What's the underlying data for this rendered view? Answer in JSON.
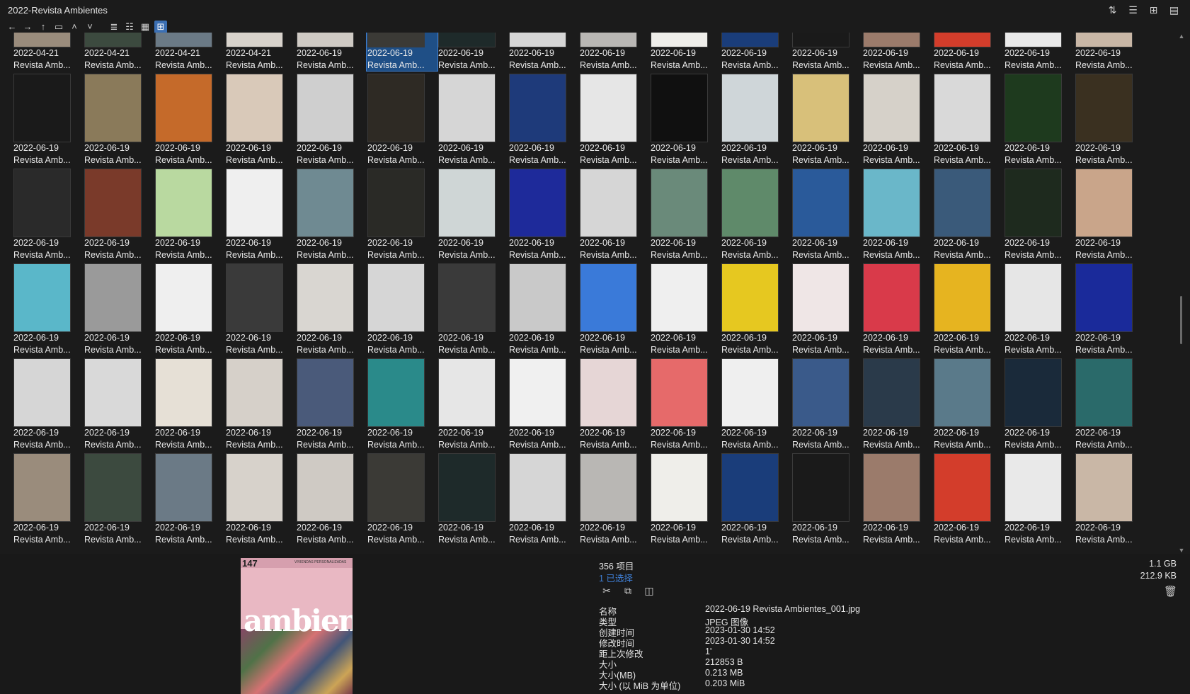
{
  "window": {
    "title": "2022-Revista Ambientes"
  },
  "icons": {
    "sort": "sort-icon",
    "details": "details-view-icon",
    "add": "add-pane-icon",
    "clipboard": "clipboard-icon",
    "back": "back-arrow-icon",
    "forward": "forward-arrow-icon",
    "up": "up-arrow-icon",
    "folder": "folder-icon",
    "chev_up": "chevron-up-icon",
    "chev_down": "chevron-down-icon"
  },
  "grid": {
    "rows": [
      [
        "2022-04-21",
        "2022-04-21",
        "2022-04-21",
        "2022-04-21",
        "2022-06-19",
        "2022-06-19",
        "2022-06-19",
        "2022-06-19",
        "2022-06-19",
        "2022-06-19",
        "2022-06-19",
        "2022-06-19",
        "2022-06-19",
        "2022-06-19",
        "2022-06-19",
        "2022-06-19"
      ],
      [
        "2022-06-19",
        "2022-06-19",
        "2022-06-19",
        "2022-06-19",
        "2022-06-19",
        "2022-06-19",
        "2022-06-19",
        "2022-06-19",
        "2022-06-19",
        "2022-06-19",
        "2022-06-19",
        "2022-06-19",
        "2022-06-19",
        "2022-06-19",
        "2022-06-19",
        "2022-06-19"
      ],
      [
        "2022-06-19",
        "2022-06-19",
        "2022-06-19",
        "2022-06-19",
        "2022-06-19",
        "2022-06-19",
        "2022-06-19",
        "2022-06-19",
        "2022-06-19",
        "2022-06-19",
        "2022-06-19",
        "2022-06-19",
        "2022-06-19",
        "2022-06-19",
        "2022-06-19",
        "2022-06-19"
      ],
      [
        "2022-06-19",
        "2022-06-19",
        "2022-06-19",
        "2022-06-19",
        "2022-06-19",
        "2022-06-19",
        "2022-06-19",
        "2022-06-19",
        "2022-06-19",
        "2022-06-19",
        "2022-06-19",
        "2022-06-19",
        "2022-06-19",
        "2022-06-19",
        "2022-06-19",
        "2022-06-19"
      ],
      [
        "2022-06-19",
        "2022-06-19",
        "2022-06-19",
        "2022-06-19",
        "2022-06-19",
        "2022-06-19",
        "2022-06-19",
        "2022-06-19",
        "2022-06-19",
        "2022-06-19",
        "2022-06-19",
        "2022-06-19",
        "2022-06-19",
        "2022-06-19",
        "2022-06-19",
        "2022-06-19"
      ],
      [
        "2022-06-19",
        "2022-06-19",
        "2022-06-19",
        "2022-06-19",
        "2022-06-19",
        "2022-06-19",
        "2022-06-19",
        "2022-06-19",
        "2022-06-19",
        "2022-06-19",
        "2022-06-19",
        "2022-06-19",
        "2022-06-19",
        "2022-06-19",
        "2022-06-19",
        "2022-06-19"
      ]
    ],
    "name_label": "Revista Amb...",
    "selected_row": 0,
    "selected_col": 5
  },
  "status": {
    "count": "356 项目",
    "selected": "1 已选择",
    "total_size": "1.1 GB",
    "selected_size": "212.9 KB"
  },
  "preview": {
    "issue": "147",
    "subtitle": "VIVIENDAS PERSONALIZADAS",
    "logo": "ambientes"
  },
  "properties": [
    {
      "key": "名称",
      "value": "2022-06-19 Revista Ambientes_001.jpg"
    },
    {
      "key": "类型",
      "value": "JPEG 图像"
    },
    {
      "key": "创建时间",
      "value": "2023-01-30   14:52"
    },
    {
      "key": "修改时间",
      "value": "2023-01-30   14:52"
    },
    {
      "key": "距上次修改",
      "value": "1'"
    },
    {
      "key": "大小",
      "value": "212853 B"
    },
    {
      "key": "大小(MB)",
      "value": "0.213 MB"
    },
    {
      "key": "大小 (以 MiB 为单位)",
      "value": "0.203 MiB"
    }
  ],
  "thumb_colors": [
    "#9a8c7c",
    "#3c4a3f",
    "#6b7a86",
    "#d7d2cb",
    "#cfcac4",
    "#3b3a36",
    "#1e2a2a",
    "#d6d6d6",
    "#b9b7b4",
    "#efeeea",
    "#1a3d7a",
    "#1a1a1a",
    "#9b7b6b",
    "#d33d2b",
    "#e9e9e9",
    "#c9b7a6",
    "#1a1a1a",
    "#8a7a5a",
    "#c56a2a",
    "#d9c9b9",
    "#cfcfcf",
    "#2e2a24",
    "#d6d6d6",
    "#1e3a7a",
    "#e6e6e6",
    "#101010",
    "#cfd6d9",
    "#d8c07a",
    "#d6d1c9",
    "#d9d9d9",
    "#1e3a1e",
    "#3a3020",
    "#2a2a2a",
    "#7a3a2a",
    "#b9d9a0",
    "#efefef",
    "#6f8a92",
    "#2a2a26",
    "#cfd6d6",
    "#1e2a9a",
    "#d6d6d6",
    "#6a8a7a",
    "#5f8a6a",
    "#2a5a9a",
    "#6ab7c9",
    "#3a5a7a",
    "#1e2a1e",
    "#c9a58a",
    "#5ab7c9",
    "#9a9a9a",
    "#efefef",
    "#3a3a3a",
    "#d9d6d1",
    "#d6d6d6",
    "#3a3a3a",
    "#c9c9c9",
    "#3a7ad9",
    "#efefef",
    "#e6c820",
    "#efe6e6",
    "#d93a4a",
    "#e6b420",
    "#e6e6e6",
    "#1a2a9a",
    "#d6d6d6",
    "#d9d9d9",
    "#e6e0d6",
    "#d6d0c9",
    "#4a5a7a",
    "#2a8a8a",
    "#e6e6e6",
    "#f0f0f0",
    "#e6d6d6",
    "#e66a6a",
    "#efefef",
    "#3a5a8a",
    "#2a3a4a",
    "#5a7a8a",
    "#1a2a3a",
    "#2a6a6a"
  ]
}
